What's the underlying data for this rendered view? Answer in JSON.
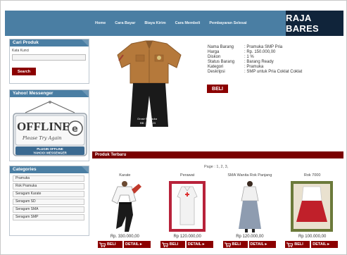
{
  "nav": {
    "items": [
      "Home",
      "Cara Bayar",
      "Biaya Kirim",
      "Cara Membeli",
      "Pembayaran Selesai"
    ],
    "brand": "RAJA BARES"
  },
  "sidebar": {
    "search": {
      "title": "Cari Produk",
      "label": "Kata Kunci",
      "button": "Search"
    },
    "messenger": {
      "title": "Yahoo! Messenger",
      "status_text": "OFFLINE",
      "sub_text": "Please Try Again",
      "caption_1": "PLUGIN OFFLINE",
      "caption_2": "YAHOO! MESSENGER"
    },
    "categories": {
      "title": "Categories",
      "items": [
        "Pramuka",
        "Rok Pramuka",
        "Seragam Karate",
        "Seragam SD",
        "Seragam SMA",
        "Seragam SMP"
      ]
    }
  },
  "product": {
    "fields": [
      {
        "key": "Nama Barang",
        "value": ": Pramuka SMP Pria"
      },
      {
        "key": "Harga",
        "value": ": Rp. 150.000,00"
      },
      {
        "key": "Diskon",
        "value": ": 1 %"
      },
      {
        "key": "Status Barang",
        "value": ": Barang Ready"
      },
      {
        "key": "Kategori",
        "value": ": Pramuka"
      },
      {
        "key": "Deskripsi",
        "value": ": SMP untuk Pria Coklat Coklat"
      }
    ],
    "buy_button": "BELI",
    "image_caption": "Grosir Pramuka",
    "image_caption_2": "BB : 000123"
  },
  "latest": {
    "title": "Produk Terbaru",
    "pagination": "Page : 1, 2, 3,",
    "items": [
      {
        "name": "Karate",
        "price": "Rp. 330.000,00",
        "img": "karate"
      },
      {
        "name": "Perawat",
        "price": "Rp 120.000,00",
        "img": "nurse"
      },
      {
        "name": "SMA Wanita Rok Panjang",
        "price": "Rp 120.000,00",
        "img": "sma"
      },
      {
        "name": "Rok 7000",
        "price": "Rp 100.000,00",
        "img": "skirt"
      }
    ],
    "beli_label": "BELI",
    "detail_label": "DETAIL"
  }
}
